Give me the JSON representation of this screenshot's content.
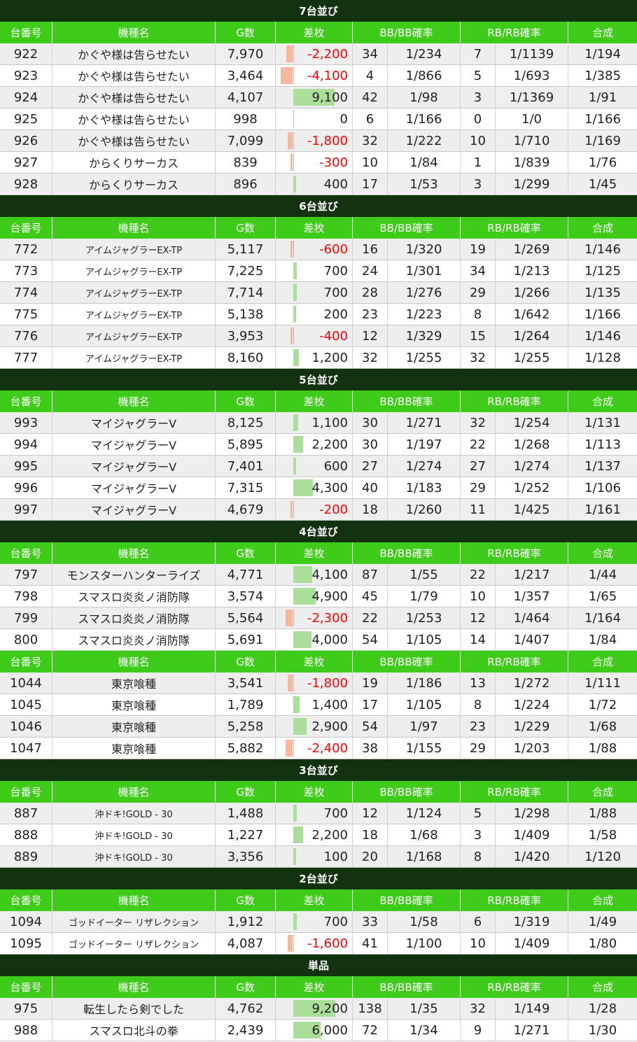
{
  "headers": [
    "台番号",
    "機種名",
    "G数",
    "差枚",
    "BB",
    "BB確率",
    "RB",
    "RB確率",
    "合成"
  ],
  "colors": {
    "section_bg": "#13320f",
    "header_bg": "#3fcb1a",
    "positive_bar": "#a9df98",
    "negative_bar": "#f6b79a",
    "negative_text": "#ff0000"
  },
  "sections": [
    {
      "title": "7台並び",
      "blocks": [
        [
          [
            "922",
            "かぐや様は告らせたい",
            "7,970",
            "-2,200",
            "34",
            "1/234",
            "7",
            "1/1139",
            "1/194"
          ],
          [
            "923",
            "かぐや様は告らせたい",
            "3,464",
            "-4,100",
            "4",
            "1/866",
            "5",
            "1/693",
            "1/385"
          ],
          [
            "924",
            "かぐや様は告らせたい",
            "4,107",
            "9,100",
            "42",
            "1/98",
            "3",
            "1/1369",
            "1/91"
          ],
          [
            "925",
            "かぐや様は告らせたい",
            "998",
            "0",
            "6",
            "1/166",
            "0",
            "1/0",
            "1/166"
          ],
          [
            "926",
            "かぐや様は告らせたい",
            "7,099",
            "-1,800",
            "32",
            "1/222",
            "10",
            "1/710",
            "1/169"
          ],
          [
            "927",
            "からくりサーカス",
            "839",
            "-300",
            "10",
            "1/84",
            "1",
            "1/839",
            "1/76"
          ],
          [
            "928",
            "からくりサーカス",
            "896",
            "400",
            "17",
            "1/53",
            "3",
            "1/299",
            "1/45"
          ]
        ]
      ]
    },
    {
      "title": "6台並び",
      "blocks": [
        [
          [
            "772",
            "アイムジャグラーEX-TP",
            "5,117",
            "-600",
            "16",
            "1/320",
            "19",
            "1/269",
            "1/146"
          ],
          [
            "773",
            "アイムジャグラーEX-TP",
            "7,225",
            "700",
            "24",
            "1/301",
            "34",
            "1/213",
            "1/125"
          ],
          [
            "774",
            "アイムジャグラーEX-TP",
            "7,714",
            "700",
            "28",
            "1/276",
            "29",
            "1/266",
            "1/135"
          ],
          [
            "775",
            "アイムジャグラーEX-TP",
            "5,138",
            "200",
            "23",
            "1/223",
            "8",
            "1/642",
            "1/166"
          ],
          [
            "776",
            "アイムジャグラーEX-TP",
            "3,953",
            "-400",
            "12",
            "1/329",
            "15",
            "1/264",
            "1/146"
          ],
          [
            "777",
            "アイムジャグラーEX-TP",
            "8,160",
            "1,200",
            "32",
            "1/255",
            "32",
            "1/255",
            "1/128"
          ]
        ]
      ]
    },
    {
      "title": "5台並び",
      "blocks": [
        [
          [
            "993",
            "マイジャグラーV",
            "8,125",
            "1,100",
            "30",
            "1/271",
            "32",
            "1/254",
            "1/131"
          ],
          [
            "994",
            "マイジャグラーV",
            "5,895",
            "2,200",
            "30",
            "1/197",
            "22",
            "1/268",
            "1/113"
          ],
          [
            "995",
            "マイジャグラーV",
            "7,401",
            "600",
            "27",
            "1/274",
            "27",
            "1/274",
            "1/137"
          ],
          [
            "996",
            "マイジャグラーV",
            "7,315",
            "4,300",
            "40",
            "1/183",
            "29",
            "1/252",
            "1/106"
          ],
          [
            "997",
            "マイジャグラーV",
            "4,679",
            "-200",
            "18",
            "1/260",
            "11",
            "1/425",
            "1/161"
          ]
        ]
      ]
    },
    {
      "title": "4台並び",
      "blocks": [
        [
          [
            "797",
            "モンスターハンターライズ",
            "4,771",
            "4,100",
            "87",
            "1/55",
            "22",
            "1/217",
            "1/44"
          ],
          [
            "798",
            "スマスロ炎炎ノ消防隊",
            "3,574",
            "4,900",
            "45",
            "1/79",
            "10",
            "1/357",
            "1/65"
          ],
          [
            "799",
            "スマスロ炎炎ノ消防隊",
            "5,564",
            "-2,300",
            "22",
            "1/253",
            "12",
            "1/464",
            "1/164"
          ],
          [
            "800",
            "スマスロ炎炎ノ消防隊",
            "5,691",
            "4,000",
            "54",
            "1/105",
            "14",
            "1/407",
            "1/84"
          ]
        ],
        [
          [
            "1044",
            "東京喰種",
            "3,541",
            "-1,800",
            "19",
            "1/186",
            "13",
            "1/272",
            "1/111"
          ],
          [
            "1045",
            "東京喰種",
            "1,789",
            "1,400",
            "17",
            "1/105",
            "8",
            "1/224",
            "1/72"
          ],
          [
            "1046",
            "東京喰種",
            "5,258",
            "2,900",
            "54",
            "1/97",
            "23",
            "1/229",
            "1/68"
          ],
          [
            "1047",
            "東京喰種",
            "5,882",
            "-2,400",
            "38",
            "1/155",
            "29",
            "1/203",
            "1/88"
          ]
        ]
      ]
    },
    {
      "title": "3台並び",
      "blocks": [
        [
          [
            "887",
            "沖ドキ!GOLD - 30",
            "1,488",
            "700",
            "12",
            "1/124",
            "5",
            "1/298",
            "1/88"
          ],
          [
            "888",
            "沖ドキ!GOLD - 30",
            "1,227",
            "2,200",
            "18",
            "1/68",
            "3",
            "1/409",
            "1/58"
          ],
          [
            "889",
            "沖ドキ!GOLD - 30",
            "3,356",
            "100",
            "20",
            "1/168",
            "8",
            "1/420",
            "1/120"
          ]
        ]
      ]
    },
    {
      "title": "2台並び",
      "blocks": [
        [
          [
            "1094",
            "ゴッドイーター リザレクション",
            "1,912",
            "700",
            "33",
            "1/58",
            "6",
            "1/319",
            "1/49"
          ],
          [
            "1095",
            "ゴッドイーター リザレクション",
            "4,087",
            "-1,600",
            "41",
            "1/100",
            "10",
            "1/409",
            "1/80"
          ]
        ]
      ]
    },
    {
      "title": "単品",
      "blocks": [
        [
          [
            "975",
            "転生したら剣でした",
            "4,762",
            "9,200",
            "138",
            "1/35",
            "32",
            "1/149",
            "1/28"
          ],
          [
            "988",
            "スマスロ北斗の拳",
            "2,439",
            "6,000",
            "72",
            "1/34",
            "9",
            "1/271",
            "1/30"
          ]
        ]
      ]
    }
  ]
}
